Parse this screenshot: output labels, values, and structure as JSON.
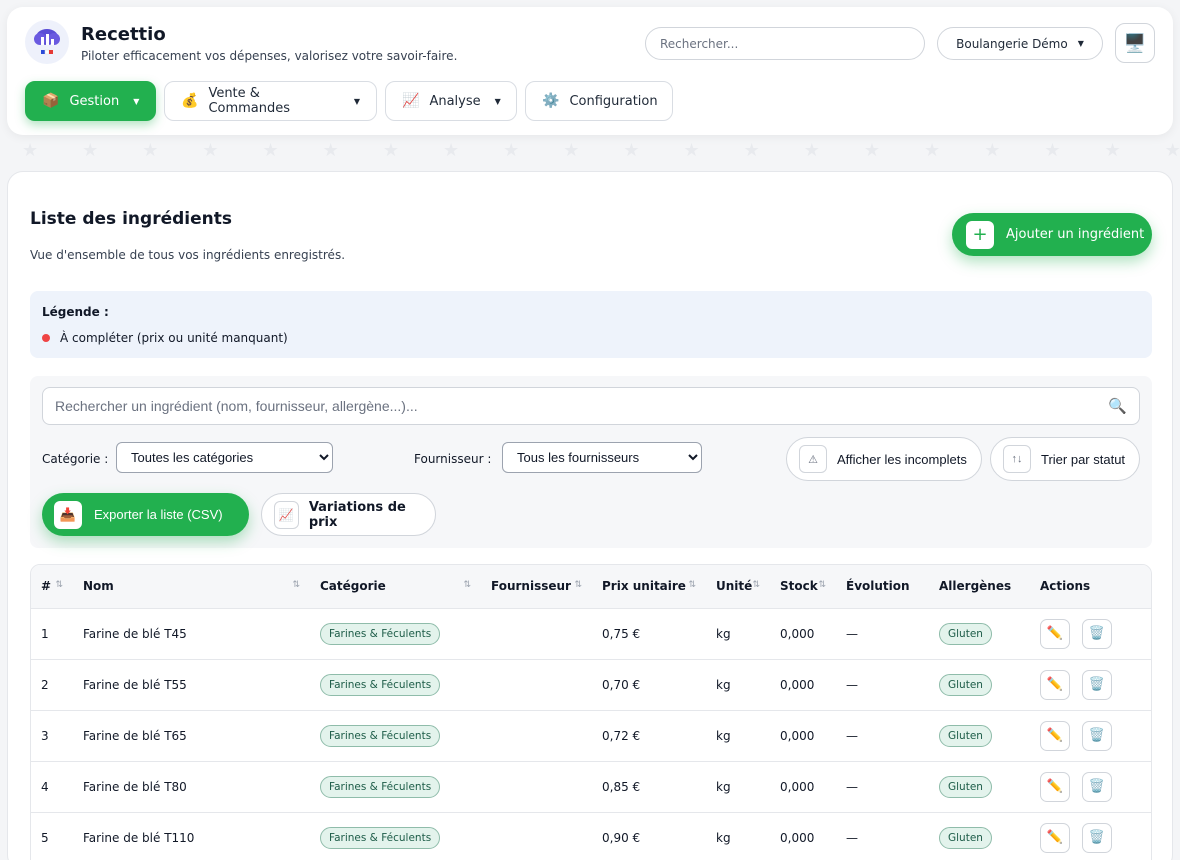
{
  "app": {
    "title": "Recettio",
    "tagline": "Piloter efficacement vos dépenses, valorisez votre savoir-faire.",
    "search_placeholder": "Rechercher...",
    "company": "Boulangerie Démo"
  },
  "nav": [
    {
      "label": "Gestion",
      "icon": "📦",
      "has_menu": true,
      "active": true
    },
    {
      "label": "Vente & Commandes",
      "icon": "💰",
      "has_menu": true
    },
    {
      "label": "Analyse",
      "icon": "📈",
      "has_menu": true
    },
    {
      "label": "Configuration",
      "icon": "⚙️",
      "has_menu": false
    }
  ],
  "page": {
    "title": "Liste des ingrédients",
    "subtitle": "Vue d'ensemble de tous vos ingrédients enregistrés.",
    "add_button": "Ajouter un ingrédient"
  },
  "legend": {
    "title": "Légende :",
    "item": "À compléter (prix ou unité manquant)"
  },
  "filters": {
    "search_placeholder": "Rechercher un ingrédient (nom, fournisseur, allergène...)...",
    "category_label": "Catégorie :",
    "category_value": "Toutes les catégories",
    "supplier_label": "Fournisseur :",
    "supplier_value": "Tous les fournisseurs",
    "show_incomplete": "Afficher les incomplets",
    "sort_status": "Trier par statut",
    "export": "Exporter la liste (CSV)",
    "price_variations": "Variations de prix"
  },
  "table": {
    "headers": [
      "#",
      "Nom",
      "Catégorie",
      "Fournisseur",
      "Prix unitaire",
      "Unité",
      "Stock",
      "Évolution",
      "Allergènes",
      "Actions"
    ],
    "rows": [
      {
        "num": "1",
        "name": "Farine de blé T45",
        "category": "Farines & Féculents",
        "supplier": "",
        "price": "0,75 €",
        "unit": "kg",
        "stock": "0,000",
        "evolution": "—",
        "allergen": "Gluten"
      },
      {
        "num": "2",
        "name": "Farine de blé T55",
        "category": "Farines & Féculents",
        "supplier": "",
        "price": "0,70 €",
        "unit": "kg",
        "stock": "0,000",
        "evolution": "—",
        "allergen": "Gluten"
      },
      {
        "num": "3",
        "name": "Farine de blé T65",
        "category": "Farines & Féculents",
        "supplier": "",
        "price": "0,72 €",
        "unit": "kg",
        "stock": "0,000",
        "evolution": "—",
        "allergen": "Gluten"
      },
      {
        "num": "4",
        "name": "Farine de blé T80",
        "category": "Farines & Féculents",
        "supplier": "",
        "price": "0,85 €",
        "unit": "kg",
        "stock": "0,000",
        "evolution": "—",
        "allergen": "Gluten"
      },
      {
        "num": "5",
        "name": "Farine de blé T110",
        "category": "Farines & Féculents",
        "supplier": "",
        "price": "0,90 €",
        "unit": "kg",
        "stock": "0,000",
        "evolution": "—",
        "allergen": "Gluten"
      }
    ]
  },
  "colors": {
    "accent": "#22b04f",
    "legend_dot": "#ef4444"
  }
}
